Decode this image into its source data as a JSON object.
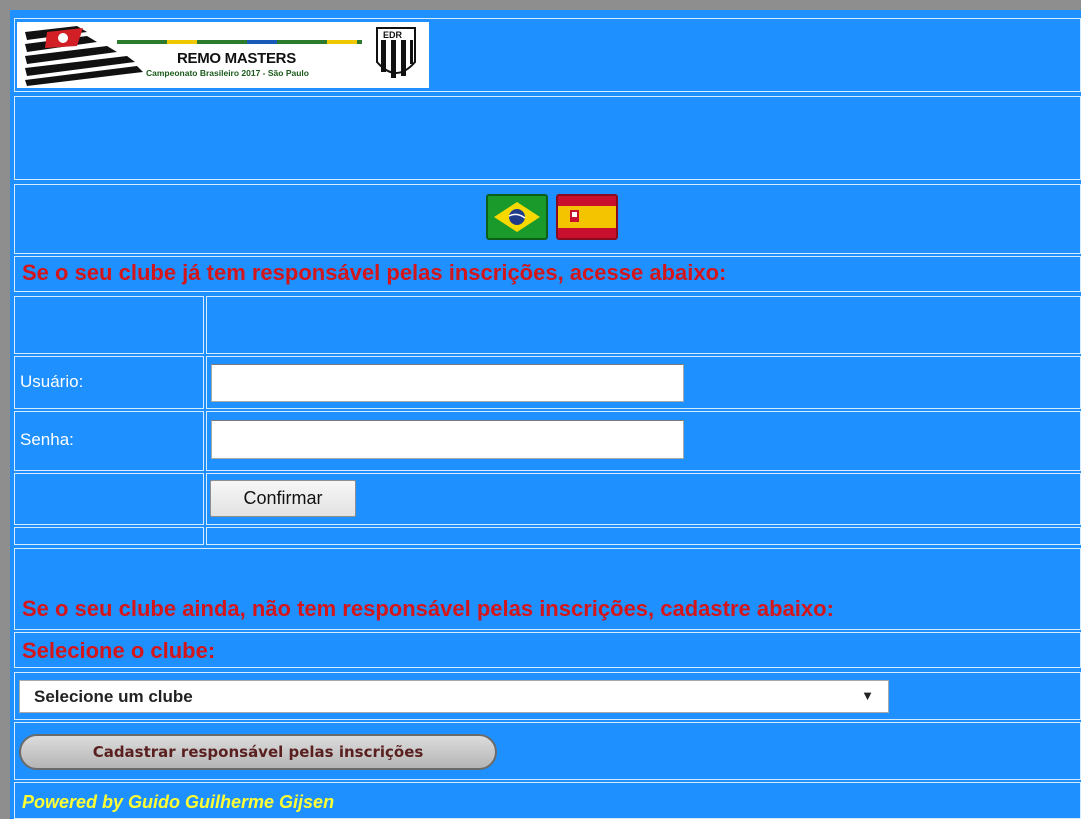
{
  "logo": {
    "title": "REMO MASTERS",
    "subtitle": "Campeonato Brasileiro 2017 - São Paulo",
    "crest_text": "EDR"
  },
  "languages": [
    {
      "name": "brazil-flag-icon"
    },
    {
      "name": "spain-flag-icon"
    }
  ],
  "login_section": {
    "heading": "Se o seu clube já tem responsável pelas inscrições, acesse abaixo:",
    "user_label": "Usuário:",
    "user_value": "",
    "password_label": "Senha:",
    "password_value": "",
    "confirm_label": "Confirmar"
  },
  "register_section": {
    "heading": "Se o seu clube ainda, não tem responsável pelas inscrições, cadastre abaixo:",
    "select_heading": "Selecione o clube:",
    "select_value": "Selecione um clube",
    "register_button": "Cadastrar responsável pelas inscrições"
  },
  "footer": {
    "powered_by": "Powered by Guido Guilherme Gijsen"
  },
  "colors": {
    "page_background": "#1e90ff",
    "heading_red": "#d4161a",
    "footer_yellow": "#ffff33",
    "cell_border": "#d6ecff"
  }
}
